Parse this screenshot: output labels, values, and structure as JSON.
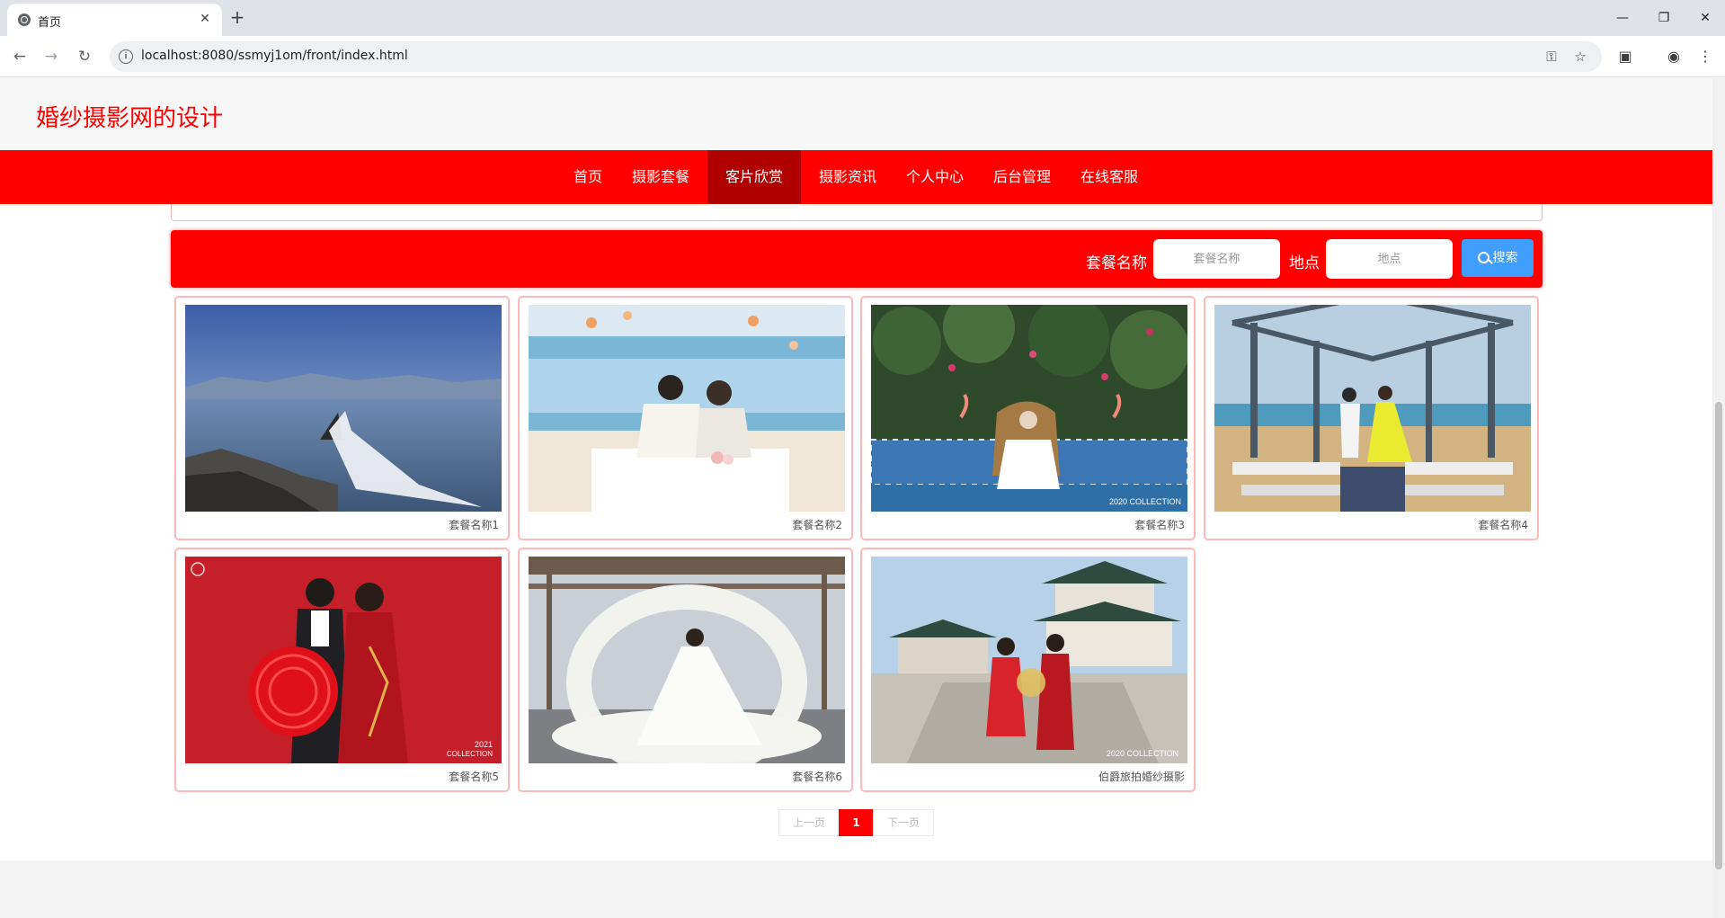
{
  "browser": {
    "tab_title": "首页",
    "close_glyph": "✕",
    "new_tab_glyph": "+",
    "url": "localhost:8080/ssmyj1om/front/index.html",
    "minimize_glyph": "—",
    "restore_glyph": "❐",
    "close_window_glyph": "✕"
  },
  "site": {
    "title": "婚纱摄影网的设计",
    "accent_color": "#ff0000"
  },
  "nav": {
    "items": [
      {
        "label": "首页"
      },
      {
        "label": "摄影套餐"
      },
      {
        "label": "客片欣赏"
      },
      {
        "label": "摄影资讯"
      },
      {
        "label": "个人中心"
      },
      {
        "label": "后台管理"
      },
      {
        "label": "在线客服"
      }
    ],
    "active": "客片欣赏"
  },
  "search": {
    "package_label": "套餐名称",
    "package_placeholder": "套餐名称",
    "location_label": "地点",
    "location_placeholder": "地点",
    "button_label": "搜索"
  },
  "cards": [
    {
      "name": "套餐名称1"
    },
    {
      "name": "套餐名称2"
    },
    {
      "name": "套餐名称3"
    },
    {
      "name": "套餐名称4"
    },
    {
      "name": "套餐名称5"
    },
    {
      "name": "套餐名称6"
    },
    {
      "name": "伯爵旅拍婚纱摄影"
    }
  ],
  "card_overlay_text": {
    "collection_2020": "2020 COLLECTION",
    "collection_2021": "2021",
    "collection_word": "COLLECTION"
  },
  "pagination": {
    "prev": "上一页",
    "current": "1",
    "next": "下一页"
  }
}
